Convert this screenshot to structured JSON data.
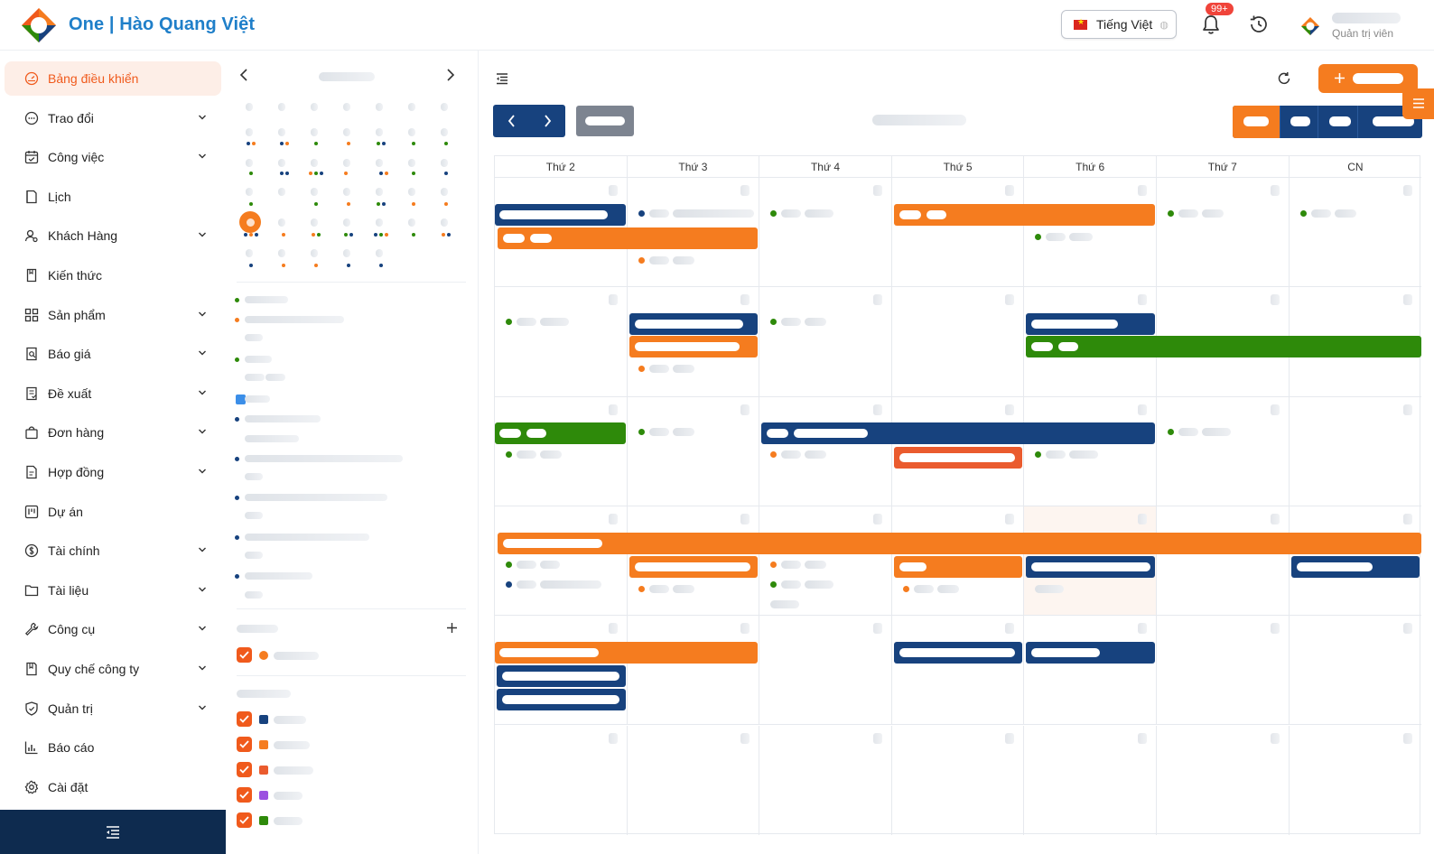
{
  "header": {
    "brand": "One | Hào Quang Việt",
    "language": "Tiếng Việt",
    "notification_count": "99+",
    "user_role": "Quản trị viên"
  },
  "sidebar": {
    "items": [
      {
        "label": "Bảng điều khiển",
        "icon": "dashboard-icon",
        "active": true,
        "chevron": false
      },
      {
        "label": "Trao đổi",
        "icon": "chat-icon",
        "chevron": true
      },
      {
        "label": "Công việc",
        "icon": "task-icon",
        "chevron": true
      },
      {
        "label": "Lịch",
        "icon": "calendar-icon",
        "chevron": false
      },
      {
        "label": "Khách Hàng",
        "icon": "customer-icon",
        "chevron": true
      },
      {
        "label": "Kiến thức",
        "icon": "book-icon",
        "chevron": false
      },
      {
        "label": "Sản phẩm",
        "icon": "grid-icon",
        "chevron": true
      },
      {
        "label": "Báo giá",
        "icon": "quote-icon",
        "chevron": true
      },
      {
        "label": "Đề xuất",
        "icon": "proposal-icon",
        "chevron": true
      },
      {
        "label": "Đơn hàng",
        "icon": "bag-icon",
        "chevron": true
      },
      {
        "label": "Hợp đồng",
        "icon": "contract-icon",
        "chevron": true
      },
      {
        "label": "Dự án",
        "icon": "project-icon",
        "chevron": false
      },
      {
        "label": "Tài chính",
        "icon": "dollar-icon",
        "chevron": true
      },
      {
        "label": "Tài liệu",
        "icon": "folder-icon",
        "chevron": true
      },
      {
        "label": "Công cụ",
        "icon": "wrench-icon",
        "chevron": true
      },
      {
        "label": "Quy chế công ty",
        "icon": "rules-icon",
        "chevron": true
      },
      {
        "label": "Quản trị",
        "icon": "shield-icon",
        "chevron": true
      },
      {
        "label": "Báo cáo",
        "icon": "report-icon",
        "chevron": false
      },
      {
        "label": "Cài đặt",
        "icon": "gear-icon",
        "chevron": false
      }
    ]
  },
  "calendar": {
    "weekdays": [
      "Thứ 2",
      "Thứ 3",
      "Thứ 4",
      "Thứ 5",
      "Thứ 6",
      "Thứ 7",
      "CN"
    ]
  },
  "colors": {
    "accent": "#f57c1f",
    "navy": "#17427e",
    "green": "#2e8a0a",
    "red": "#ea5b2e",
    "purple": "#9b51e0"
  }
}
